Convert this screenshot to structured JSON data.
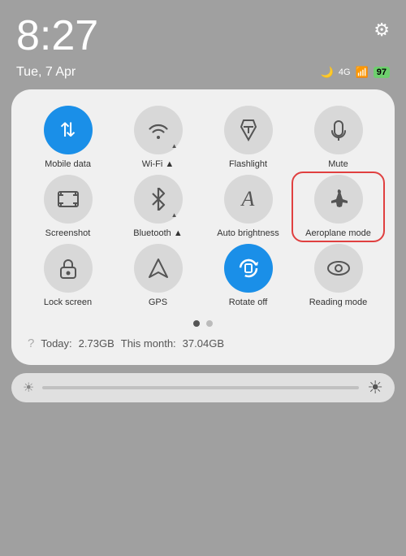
{
  "statusBar": {
    "time": "8:27",
    "date": "Tue, 7 Apr",
    "battery": "97",
    "gear": "⚙"
  },
  "tiles": {
    "row1": [
      {
        "id": "mobile-data",
        "label": "Mobile data",
        "icon": "⇅",
        "active": true
      },
      {
        "id": "wifi",
        "label": "Wi-Fi ▲",
        "icon": "📶",
        "active": false
      },
      {
        "id": "flashlight",
        "label": "Flashlight",
        "icon": "🔦",
        "active": false
      },
      {
        "id": "mute",
        "label": "Mute",
        "icon": "🔔",
        "active": false
      }
    ],
    "row2": [
      {
        "id": "screenshot",
        "label": "Screenshot",
        "icon": "✂",
        "active": false
      },
      {
        "id": "bluetooth",
        "label": "Bluetooth ▲",
        "icon": "✱",
        "active": false
      },
      {
        "id": "auto-brightness",
        "label": "Auto brightness",
        "icon": "A",
        "active": false
      },
      {
        "id": "aeroplane-mode",
        "label": "Aeroplane mode",
        "icon": "✈",
        "active": false,
        "highlighted": true
      }
    ],
    "row3": [
      {
        "id": "lock-screen",
        "label": "Lock screen",
        "icon": "🔒",
        "active": false
      },
      {
        "id": "gps",
        "label": "GPS",
        "icon": "◁",
        "active": false
      },
      {
        "id": "rotate-off",
        "label": "Rotate off",
        "icon": "🔄",
        "active": true
      },
      {
        "id": "reading-mode",
        "label": "Reading mode",
        "icon": "👁",
        "active": false
      }
    ]
  },
  "dots": {
    "active": 0,
    "total": 2
  },
  "dataUsage": {
    "todayLabel": "Today:",
    "todayValue": "2.73GB",
    "monthLabel": "This month:",
    "monthValue": "37.04GB"
  },
  "brightness": {
    "minIcon": "☀",
    "maxIcon": "☀"
  }
}
